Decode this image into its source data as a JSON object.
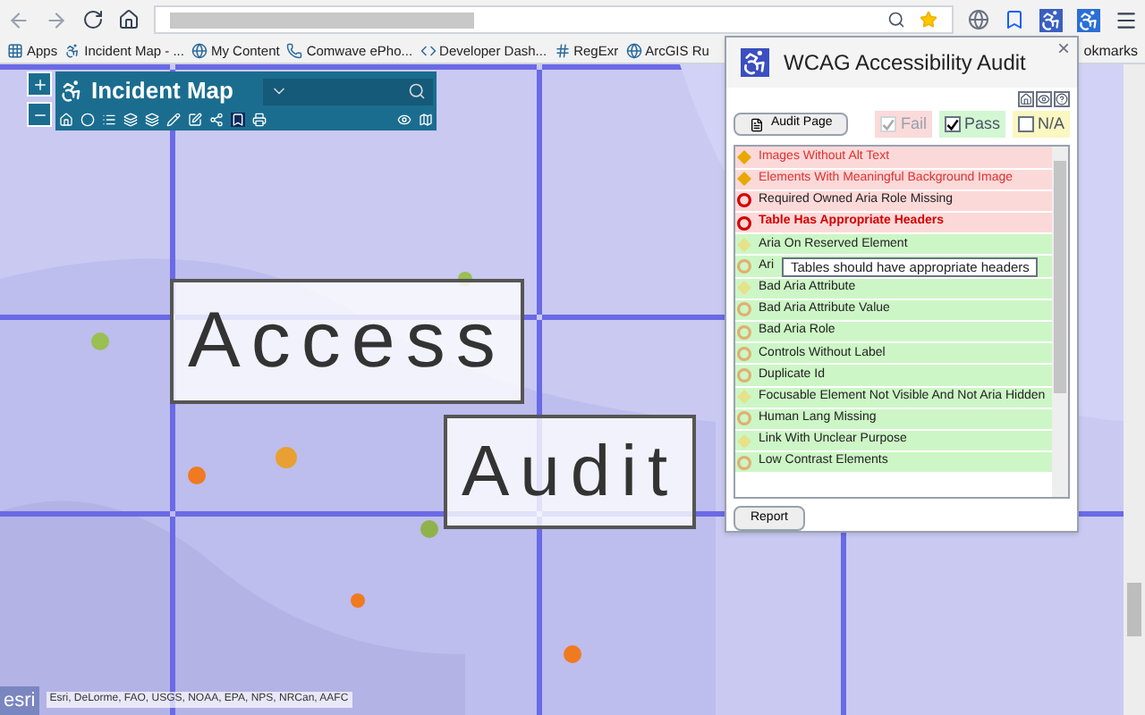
{
  "bookmarks": [
    {
      "label": "Apps",
      "kind": "apps"
    },
    {
      "label": "Incident Map - ...",
      "kind": "access"
    },
    {
      "label": "My Content",
      "kind": "globe"
    },
    {
      "label": "Comwave ePho...",
      "kind": "phone"
    },
    {
      "label": "Developer Dash...",
      "kind": "dev"
    },
    {
      "label": "RegExr",
      "kind": "regex"
    },
    {
      "label": "ArcGIS Ru",
      "kind": "globe"
    }
  ],
  "bookmarks_overflow": "okmarks",
  "map_widget": {
    "title": "Incident Map"
  },
  "banner": {
    "first": "Access",
    "second": "Audit"
  },
  "attribution": {
    "logo": "esri",
    "text": "Esri, DeLorme, FAO, USGS, NOAA, EPA, NPS, NRCan, AAFC"
  },
  "popup": {
    "title": "WCAG Accessibility Audit",
    "close": "×",
    "audit_button": "Audit Page",
    "filters": [
      {
        "label": "Fail",
        "kind": "fail",
        "checked": true,
        "disabled": true
      },
      {
        "label": "Pass",
        "kind": "pass",
        "checked": true,
        "disabled": false
      },
      {
        "label": "N/A",
        "kind": "na",
        "checked": false,
        "disabled": false
      }
    ],
    "rules": [
      {
        "label": "Images Without Alt Text",
        "failed": true,
        "kind": "warning",
        "selected": false
      },
      {
        "label": "Elements With Meaningful Background Image",
        "failed": true,
        "kind": "warning",
        "selected": false
      },
      {
        "label": "Required Owned Aria Role Missing",
        "failed": true,
        "kind": "error",
        "selected": false
      },
      {
        "label": "Table Has Appropriate Headers",
        "failed": true,
        "kind": "error",
        "selected": true
      },
      {
        "label": "Aria On Reserved Element",
        "failed": false,
        "kind": "warning",
        "selected": false
      },
      {
        "label": "Ari",
        "failed": false,
        "kind": "error",
        "selected": false,
        "tooltip": "Tables should have appropriate headers"
      },
      {
        "label": "Bad Aria Attribute",
        "failed": false,
        "kind": "warning",
        "selected": false
      },
      {
        "label": "Bad Aria Attribute Value",
        "failed": false,
        "kind": "error",
        "selected": false
      },
      {
        "label": "Bad Aria Role",
        "failed": false,
        "kind": "error",
        "selected": false
      },
      {
        "label": "Controls Without Label",
        "failed": false,
        "kind": "error",
        "selected": false
      },
      {
        "label": "Duplicate Id",
        "failed": false,
        "kind": "error",
        "selected": false
      },
      {
        "label": "Focusable Element Not Visible And Not Aria Hidden",
        "failed": false,
        "kind": "warning",
        "selected": false
      },
      {
        "label": "Human Lang Missing",
        "failed": false,
        "kind": "error",
        "selected": false
      },
      {
        "label": "Link With Unclear Purpose",
        "failed": false,
        "kind": "warning",
        "selected": false
      },
      {
        "label": "Low Contrast Elements",
        "failed": false,
        "kind": "error",
        "selected": false
      }
    ],
    "report_button": "Report"
  }
}
